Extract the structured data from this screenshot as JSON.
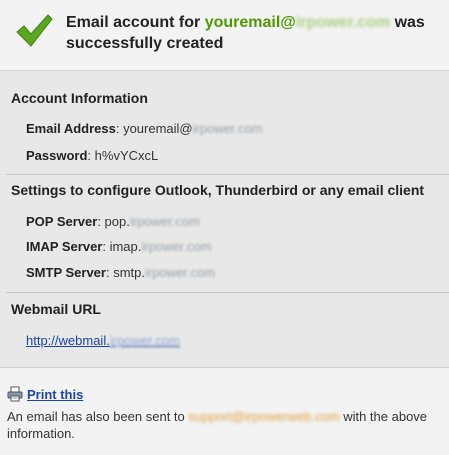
{
  "header": {
    "title_prefix": "Email account for ",
    "email_user": "youremail@",
    "email_domain": "irpower.com",
    "title_suffix": " was successfully created"
  },
  "account": {
    "section_title": "Account Information",
    "email_label": "Email Address",
    "email_value_user": "youremail@",
    "email_value_domain": "irpower.com",
    "password_label": "Password",
    "password_value": "h%vYCxcL"
  },
  "settings": {
    "section_title": "Settings to configure Outlook, Thunderbird or any email client",
    "pop_label": "POP Server",
    "pop_prefix": "pop.",
    "pop_domain": "irpower.com",
    "imap_label": "IMAP Server",
    "imap_prefix": "imap.",
    "imap_domain": "irpower.com",
    "smtp_label": "SMTP Server",
    "smtp_prefix": "smtp.",
    "smtp_domain": "irpower.com"
  },
  "webmail": {
    "section_title": "Webmail URL",
    "url_prefix": "http://webmail.",
    "url_domain": "irpower.com"
  },
  "footer": {
    "print_label": "Print this",
    "note_prefix": "An email has also been sent to ",
    "note_email": "support@irpowerweb.com",
    "note_suffix": " with the above information."
  },
  "colors": {
    "accent_green": "#4c9a00",
    "link_blue": "#1a44a8",
    "highlight_orange": "#e0a040"
  },
  "icons": {
    "success": "checkmark-icon",
    "print": "printer-icon"
  }
}
